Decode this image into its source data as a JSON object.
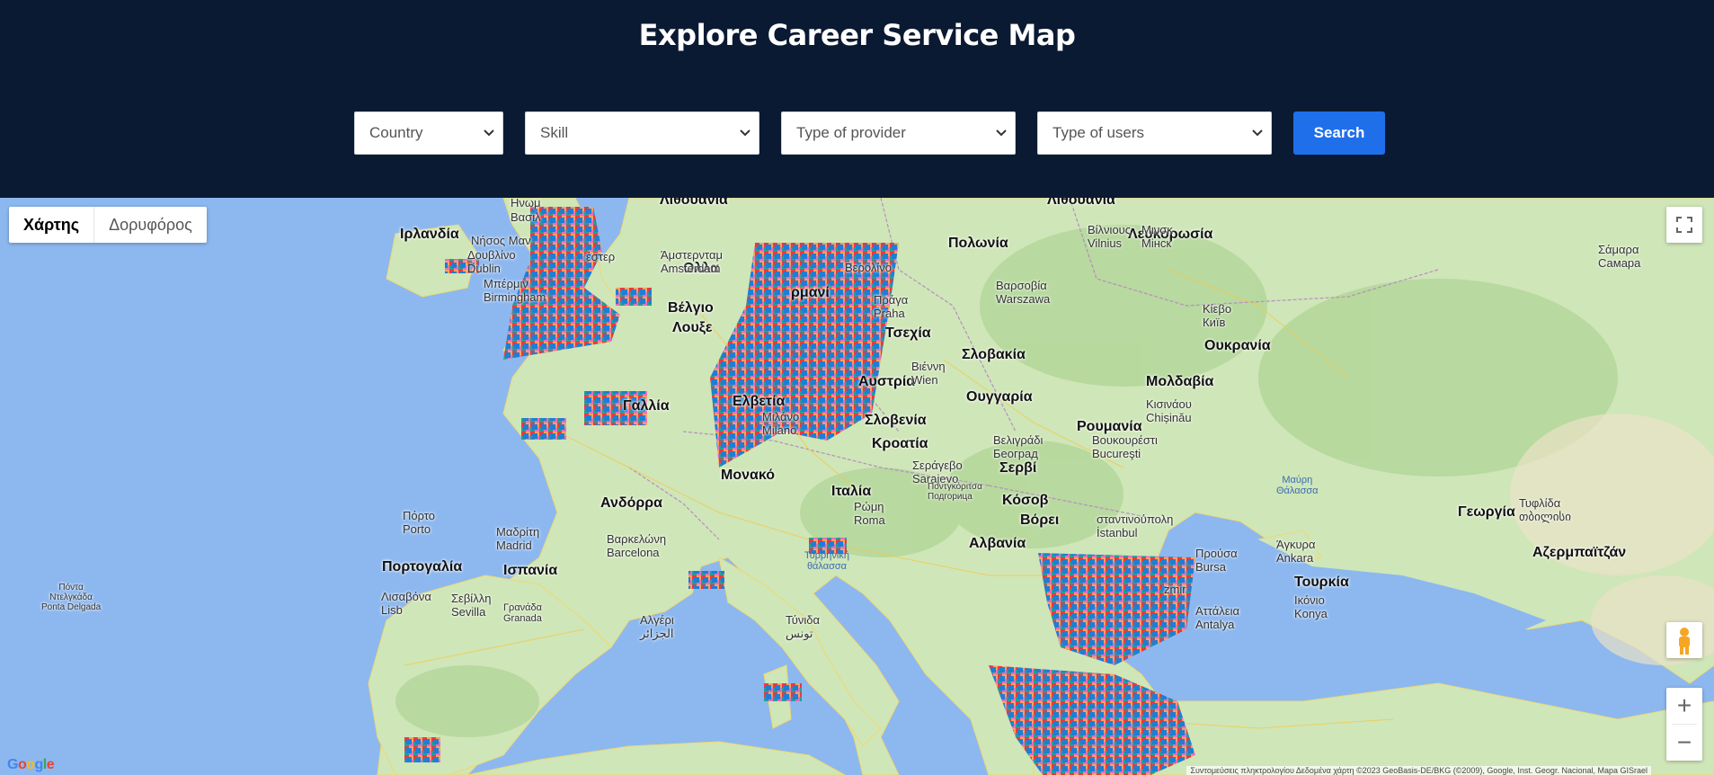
{
  "page": {
    "title": "Explore Career Service Map"
  },
  "filters": {
    "country": "Country",
    "skill": "Skill",
    "provider": "Type of provider",
    "users": "Type of users",
    "search_label": "Search"
  },
  "map": {
    "map_type_active": "Χάρτης",
    "map_type_inactive": "Δορυφόρος",
    "zoom_in": "+",
    "zoom_out": "−",
    "attribution": "Συντομεύσεις πληκτρολογίου   Δεδομένα χάρτη ©2023 GeoBasis-DE/BKG (©2009), Google, Inst. Geogr. Nacional, Mapa GISrael",
    "google_logo": "Google",
    "country_labels": {
      "irlandia": "Ιρλανδία",
      "polonia": "Πολωνία",
      "lefkorosia": "Λευκορωσία",
      "ollandia": "Ολλα",
      "velgio": "Βέλγιο",
      "louxemvourgo": "Λουξε",
      "germania": "ρμανί",
      "tsexia": "Τσεχία",
      "slovakia": "Σλοβακία",
      "oukrania": "Ουκρανία",
      "austria": "Αυστρία",
      "gallia": "Γαλλία",
      "elvetia": "Ελβετία",
      "oungaria": "Ουγγαρία",
      "moldavia": "Μολδαβία",
      "slovenia": "Σλοβενία",
      "kroatia": "Κροατία",
      "roumania": "Ρουμανία",
      "servia": "Σερβί",
      "monako": "Μονακό",
      "andorra": "Ανδόρρα",
      "italia": "Ιταλία",
      "kosovo": "Κόσοβ",
      "voreia": "Βόρει",
      "albania": "Αλβανία",
      "portogalia": "Πορτογαλία",
      "ispania": "Ισπανία",
      "tourkia": "Τουρκία",
      "georgia": "Γεωργία",
      "azerbaitzan": "Αζερμπαϊτζάν",
      "lithouania": "Λιθουανία"
    },
    "city_labels": {
      "dublin": "Δουβλίνο\nDublin",
      "birmingham": "Μπέρμιν\nBirmingham",
      "amsterdam": "Άμστερνταμ\nAmsterdam",
      "berlin": "Βερολίνο",
      "vilnius": "Βίλνιους\nVilnius",
      "minsk": "Μινσκ\nМінск",
      "warsaw": "Βαρσοβία\nWarszawa",
      "praha": "Πράγα\nPraha",
      "kiev": "Κίεβο\nКиїв",
      "samara": "Σάμαρα\nСамара",
      "wien": "Βιέννη\nWien",
      "chisinau": "Κισινάου\nChișinău",
      "milano": "Μιλάνο\nMilano",
      "belgrad": "Βελιγράδι\nБеоград",
      "bucuresti": "Βουκουρέστι\nBucureşti",
      "sarajevo": "Σεράγεβο\nSarajevo",
      "podgorica": "Ποντγκόριτσα\nПодгорица",
      "roma": "Ρώμη\nRoma",
      "istanbul": "σταντινούπολη\nİstanbul",
      "porto": "Πόρτο\nPorto",
      "madrid": "Μαδρίτη\nMadrid",
      "barcelona": "Βαρκελώνη\nBarcelona",
      "lisboa": "Λισαβόνα\nLisb",
      "sevilla": "Σεβίλλη\nSevilla",
      "granada": "Γρανάδα\nGranada",
      "alger": "Αλγέρι\nالجزائر",
      "tunis": "Τύνιδα\nتونس",
      "ankara": "Άγκυρα\nAnkara",
      "bursa": "Προύσα\nBursa",
      "konya": "Ικόνιο\nKonya",
      "antalya": "Αττάλεια\nAntalya",
      "tbilisi": "Τυφλίδα\nთბილისი",
      "ponta": "Πόντα\nΝτελγκάδα\nPonta Delgada",
      "izmir": "zmir",
      "nisos_man": "Νήσος Μαν",
      "ester": "έστερ",
      "hnom": "Ηνωμ",
      "vasil": "Βασιλ",
      "tyrrhenian": "Τυρρηνική\nθάλασσα",
      "mavri": "Μαύρη\nΘάλασσα"
    }
  }
}
